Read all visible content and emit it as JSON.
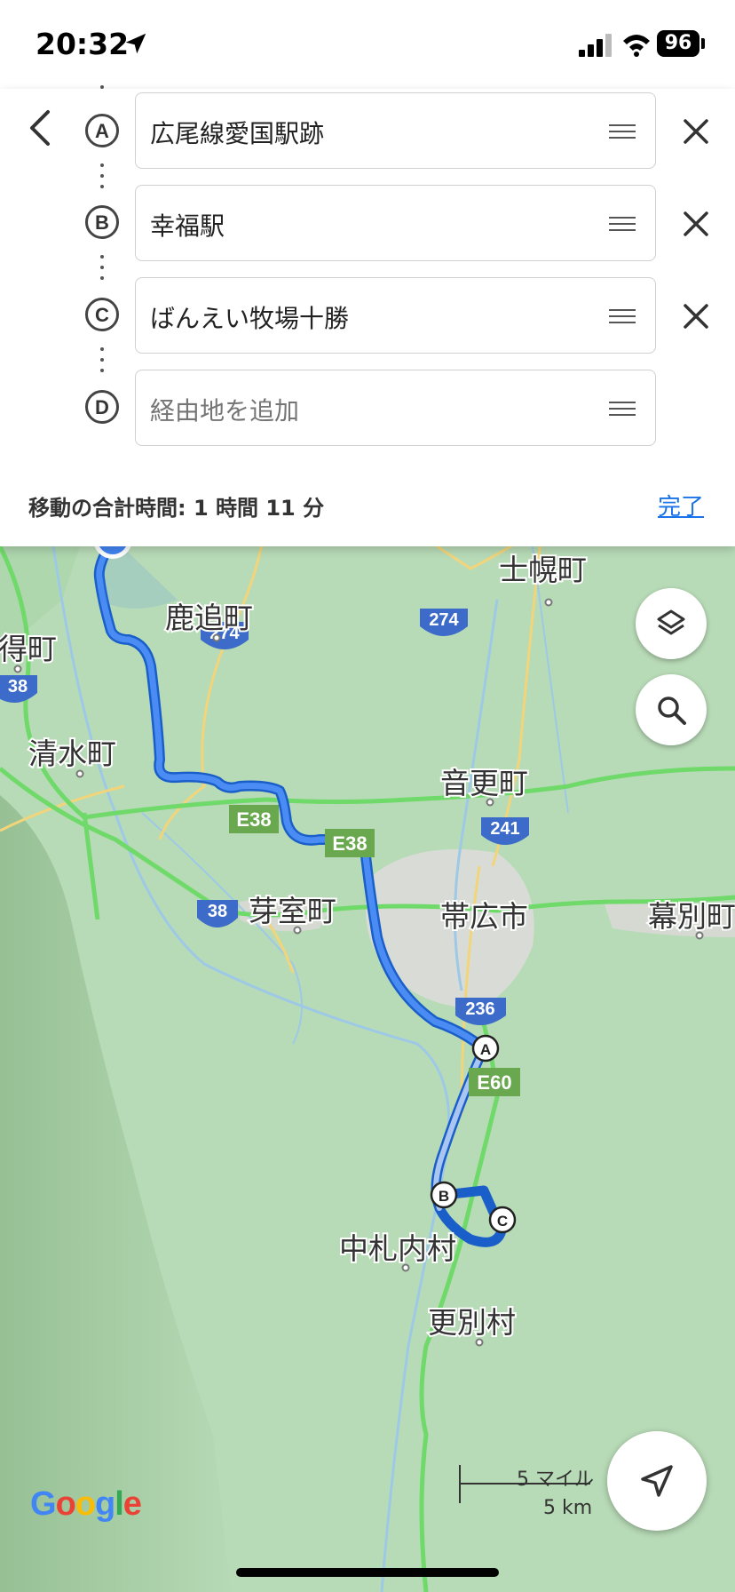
{
  "status_bar": {
    "time": "20:32",
    "battery": "96"
  },
  "route": {
    "stops": [
      {
        "letter": "A",
        "name": "広尾線愛国駅跡"
      },
      {
        "letter": "B",
        "name": "幸福駅"
      },
      {
        "letter": "C",
        "name": "ばんえい牧場十勝"
      }
    ],
    "add_stop": {
      "letter": "D",
      "placeholder": "経由地を追加"
    },
    "total_time": "移動の合計時間: 1 時間 11 分",
    "done_label": "完了"
  },
  "map": {
    "places": [
      "士幌町",
      "鹿追町",
      "得町",
      "清水町",
      "音更町",
      "芽室町",
      "帯広市",
      "幕別町",
      "中札内村",
      "更別村"
    ],
    "road_shields": [
      "274",
      "274",
      "38",
      "E38",
      "E38",
      "241",
      "38",
      "236",
      "E60"
    ],
    "markers": [
      "A",
      "B",
      "C"
    ],
    "scale": {
      "imperial": "5 マイル",
      "metric": "5 km"
    },
    "attribution": "Google",
    "icons": [
      "layers-icon",
      "search-icon",
      "navigate-icon"
    ]
  },
  "colors": {
    "route": "#4285f4",
    "map_bg": "#b5d9b4",
    "highway": "#6fd96a",
    "accent": "#1a73e8"
  }
}
